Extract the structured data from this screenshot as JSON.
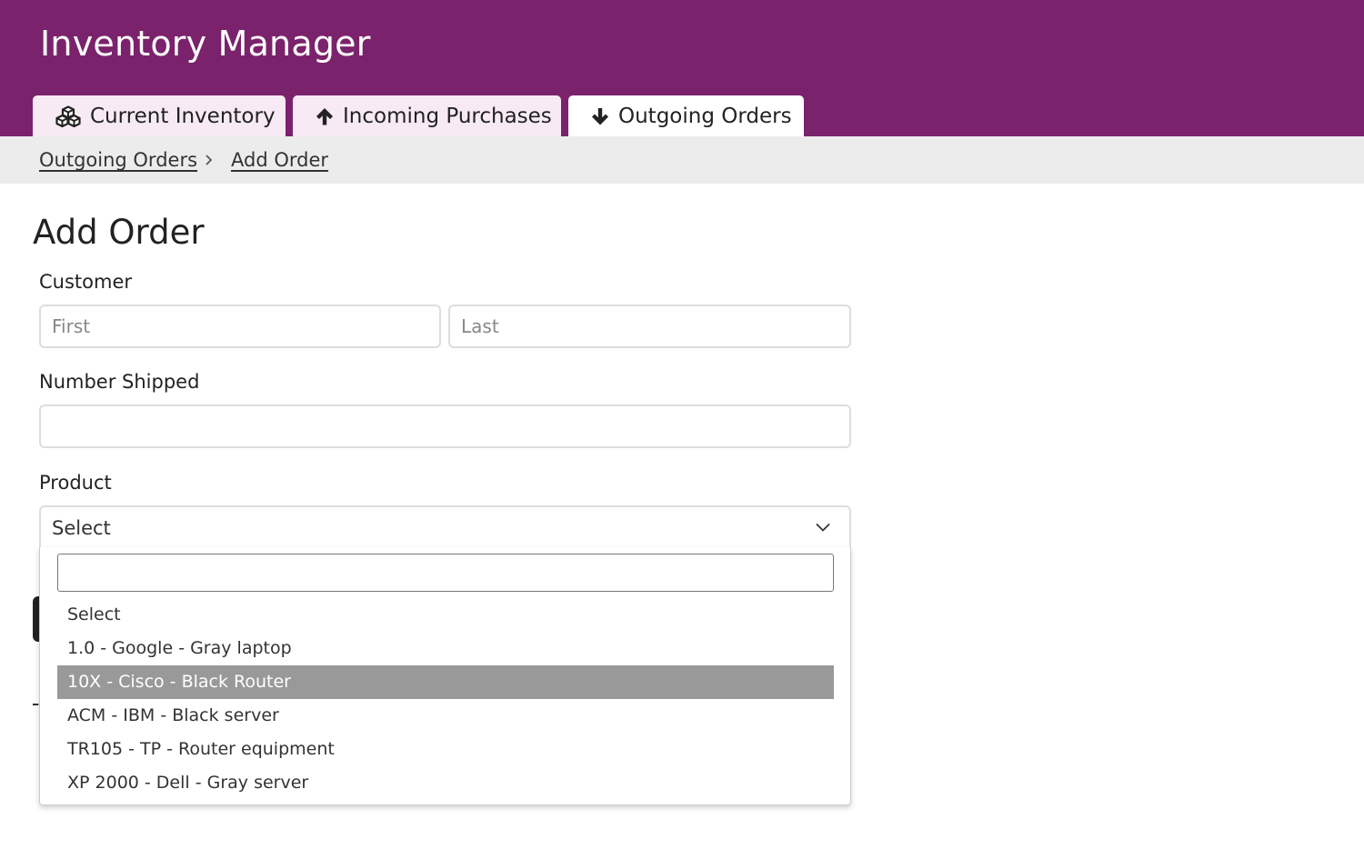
{
  "header": {
    "title": "Inventory Manager",
    "background_color": "#7b226d"
  },
  "tabs": [
    {
      "label": "Current Inventory",
      "icon": "cubes-icon",
      "active": false
    },
    {
      "label": "Incoming Purchases",
      "icon": "arrow-up-icon",
      "active": false
    },
    {
      "label": "Outgoing Orders",
      "icon": "arrow-down-icon",
      "active": true
    }
  ],
  "breadcrumb": [
    {
      "label": "Outgoing Orders"
    },
    {
      "label": "Add Order"
    }
  ],
  "page": {
    "title": "Add Order"
  },
  "form": {
    "customer": {
      "label": "Customer",
      "first_placeholder": "First",
      "first_value": "",
      "last_placeholder": "Last",
      "last_value": ""
    },
    "number_shipped": {
      "label": "Number Shipped",
      "value": ""
    },
    "product": {
      "label": "Product",
      "selected": "Select",
      "search_value": "",
      "options": [
        "Select",
        "1.0 - Google - Gray laptop",
        "10X - Cisco - Black Router",
        "ACM - IBM - Black server",
        "TR105 - TP - Router equipment",
        "XP 2000 - Dell - Gray server"
      ],
      "highlighted_index": 2,
      "highlight_color": "#999999"
    }
  }
}
